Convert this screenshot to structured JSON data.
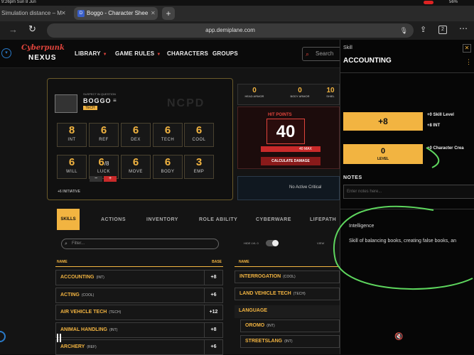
{
  "status": {
    "time": "9:26pm  Sun 8 Jun",
    "battery": "56%"
  },
  "browser": {
    "tabs": [
      {
        "label": "Simulation distance – M"
      },
      {
        "label": "Boggo - Character Shee"
      }
    ],
    "new_tab": "+",
    "url": "app.demiplane.com",
    "tab_count": "2"
  },
  "site": {
    "logo_top": "Cyberpunk",
    "logo_bottom": "NEXUS",
    "nav": [
      "LIBRARY",
      "GAME RULES",
      "CHARACTERS",
      "GROUPS"
    ],
    "search_placeholder": "Search"
  },
  "character": {
    "suspect_label": "SUSPECT IN QUESTION",
    "name": "BOGGO",
    "role": "TECH",
    "watermark": "NCPD",
    "initiative": "+6 INITIATIVE",
    "stats_top": [
      {
        "label": "INT",
        "value": "8"
      },
      {
        "label": "REF",
        "value": "6"
      },
      {
        "label": "DEX",
        "value": "6"
      },
      {
        "label": "TECH",
        "value": "6"
      },
      {
        "label": "COOL",
        "value": "6"
      }
    ],
    "stats_bottom": [
      {
        "label": "WILL",
        "value": "6"
      },
      {
        "label": "LUCK",
        "value": "6",
        "sub": "/8"
      },
      {
        "label": "MOVE",
        "value": "6"
      },
      {
        "label": "BODY",
        "value": "6"
      },
      {
        "label": "EMP",
        "value": "3"
      }
    ],
    "luck_minus": "−",
    "luck_plus": "+",
    "armor": [
      {
        "label": "HEAD ARMOR",
        "value": "0"
      },
      {
        "label": "BODY ARMOR",
        "value": "0"
      },
      {
        "label": "SHIEL",
        "value": "10"
      }
    ],
    "hp_label": "HIT POINTS",
    "hp": "40",
    "hp_max": "40 MAX",
    "calc_damage": "CALCULATE DAMAGE",
    "critical": "No Active Critical"
  },
  "tabs": [
    "SKILLS",
    "ACTIONS",
    "INVENTORY",
    "ROLE ABILITY",
    "CYBERWARE",
    "LIFEPATH"
  ],
  "filter_placeholder": "Filter...",
  "hide_lvl": "HIDE LVL 0",
  "view": "VIEW",
  "left_col": {
    "name": "NAME",
    "base": "BASE",
    "rows": [
      {
        "name": "ACCOUNTING",
        "tag": "(INT)",
        "value": "+8"
      },
      {
        "name": "ACTING",
        "tag": "(COOL)",
        "value": "+6"
      },
      {
        "name": "AIR VEHICLE TECH",
        "tag": "(TECH)",
        "value": "+12"
      },
      {
        "name": "ANIMAL HANDLING",
        "tag": "(INT)",
        "value": "+8"
      },
      {
        "name": "ARCHERY",
        "tag": "(REF)",
        "value": "+6"
      }
    ]
  },
  "right_col": {
    "name": "NAME",
    "rows": [
      {
        "name": "INTERROGATION",
        "tag": "(COOL)"
      },
      {
        "name": "LAND VEHICLE TECH",
        "tag": "(TECH)"
      },
      {
        "name": "LANGUAGE",
        "tag": ""
      },
      {
        "name": "OROMO",
        "tag": "(INT)"
      },
      {
        "name": "STREETSLANG",
        "tag": "(INT)"
      }
    ]
  },
  "panel": {
    "kicker": "Skill",
    "title": "ACCOUNTING",
    "total": "+8",
    "skill_level": "+0 Skill Level",
    "int_bonus": "+8 INT",
    "level_value": "0",
    "level_label": "LEVEL",
    "char_creation": "+0 Character Crea",
    "notes_label": "NOTES",
    "notes_placeholder": "Enter notes here...",
    "stat_name": "Intelligence",
    "description": "Skill of balancing books, creating false books, an"
  },
  "colors": {
    "accent": "#f2b441",
    "red": "#e0443c",
    "annotation": "#5ed65e"
  }
}
